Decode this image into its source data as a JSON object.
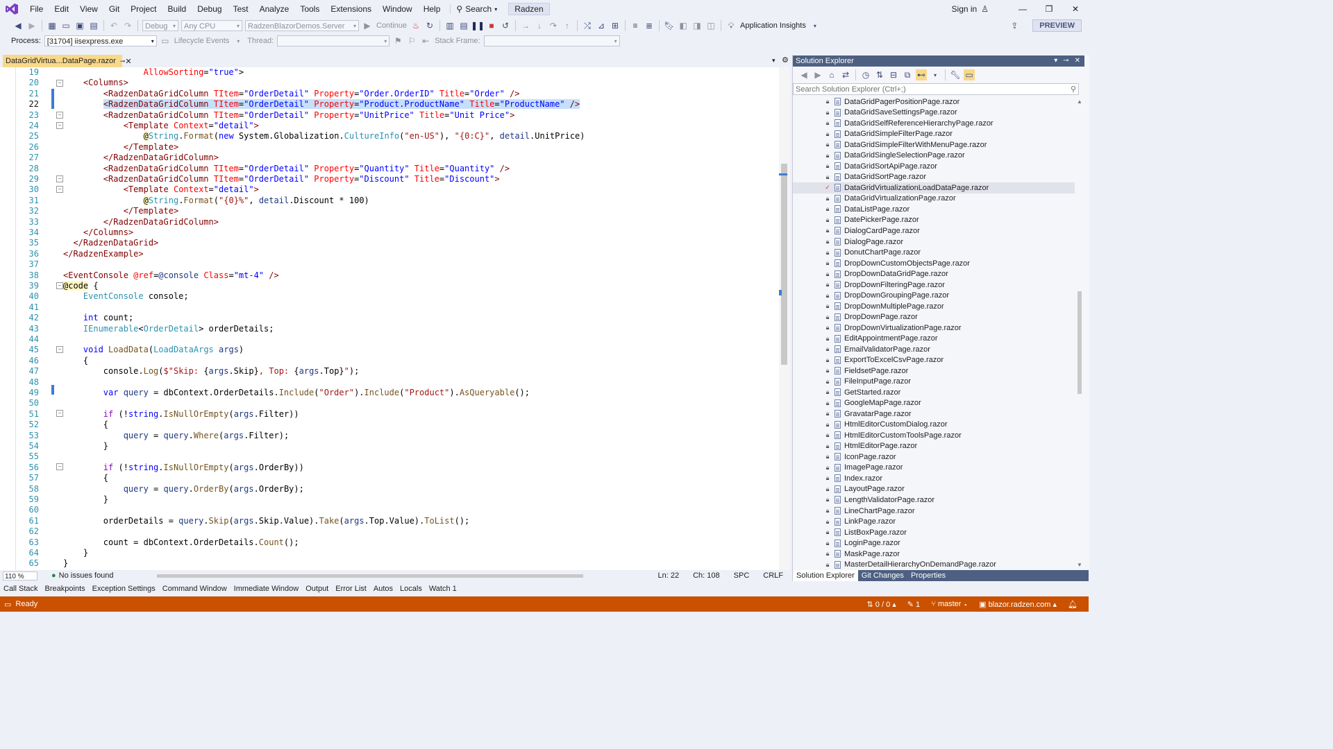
{
  "menu": {
    "items": [
      "File",
      "Edit",
      "View",
      "Git",
      "Project",
      "Build",
      "Debug",
      "Test",
      "Analyze",
      "Tools",
      "Extensions",
      "Window",
      "Help"
    ],
    "search_label": "Search",
    "solution_name": "Radzen",
    "sign_in": "Sign in"
  },
  "toolbar": {
    "config": "Debug",
    "platform": "Any CPU",
    "startup_project": "RadzenBlazorDemos.Server",
    "continue_label": "Continue",
    "app_insights": "Application Insights",
    "preview": "PREVIEW",
    "process_label": "Process:",
    "process_value": "[31704] iisexpress.exe",
    "lifecycle_label": "Lifecycle Events",
    "thread_label": "Thread:",
    "stack_frame_label": "Stack Frame:"
  },
  "editor": {
    "tab_title": "DataGridVirtua...DataPage.razor",
    "current_line": 22,
    "line_numbers": [
      19,
      20,
      21,
      22,
      23,
      24,
      25,
      26,
      27,
      28,
      29,
      30,
      31,
      32,
      33,
      34,
      35,
      36,
      37,
      38,
      39,
      40,
      41,
      42,
      43,
      44,
      45,
      46,
      47,
      48,
      49,
      50,
      51,
      52,
      53,
      54,
      55,
      56,
      57,
      58,
      59,
      60,
      61,
      62,
      63,
      64,
      65
    ]
  },
  "editor_status": {
    "zoom": "110 %",
    "issues": "No issues found",
    "line": "Ln: 22",
    "col": "Ch: 108",
    "spc": "SPC",
    "eol": "CRLF"
  },
  "bottom_tabs": [
    "Call Stack",
    "Breakpoints",
    "Exception Settings",
    "Command Window",
    "Immediate Window",
    "Output",
    "Error List",
    "Autos",
    "Locals",
    "Watch 1"
  ],
  "status_bar": {
    "ready": "Ready",
    "sync": "0 / 0",
    "pencil": "1",
    "branch": "master",
    "repo": "blazor.radzen.com"
  },
  "solution_explorer": {
    "title": "Solution Explorer",
    "search_placeholder": "Search Solution Explorer (Ctrl+;)",
    "selected": "DataGridVirtualizationLoadDataPage.razor",
    "files": [
      "DataGridPagerPositionPage.razor",
      "DataGridSaveSettingsPage.razor",
      "DataGridSelfReferenceHierarchyPage.razor",
      "DataGridSimpleFilterPage.razor",
      "DataGridSimpleFilterWithMenuPage.razor",
      "DataGridSingleSelectionPage.razor",
      "DataGridSortApiPage.razor",
      "DataGridSortPage.razor",
      "DataGridVirtualizationLoadDataPage.razor",
      "DataGridVirtualizationPage.razor",
      "DataListPage.razor",
      "DatePickerPage.razor",
      "DialogCardPage.razor",
      "DialogPage.razor",
      "DonutChartPage.razor",
      "DropDownCustomObjectsPage.razor",
      "DropDownDataGridPage.razor",
      "DropDownFilteringPage.razor",
      "DropDownGroupingPage.razor",
      "DropDownMultiplePage.razor",
      "DropDownPage.razor",
      "DropDownVirtualizationPage.razor",
      "EditAppointmentPage.razor",
      "EmailValidatorPage.razor",
      "ExportToExcelCsvPage.razor",
      "FieldsetPage.razor",
      "FileInputPage.razor",
      "GetStarted.razor",
      "GoogleMapPage.razor",
      "GravatarPage.razor",
      "HtmlEditorCustomDialog.razor",
      "HtmlEditorCustomToolsPage.razor",
      "HtmlEditorPage.razor",
      "IconPage.razor",
      "ImagePage.razor",
      "Index.razor",
      "LayoutPage.razor",
      "LengthValidatorPage.razor",
      "LineChartPage.razor",
      "LinkPage.razor",
      "ListBoxPage.razor",
      "LoginPage.razor",
      "MaskPage.razor",
      "MasterDetailHierarchyOnDemandPage.razor"
    ],
    "tabs": [
      "Solution Explorer",
      "Git Changes",
      "Properties"
    ]
  },
  "colors": {
    "accent": "#ca5100",
    "keyword": "#0000ff",
    "type": "#2b91af",
    "tag": "#800000",
    "attr": "#ff0000"
  }
}
